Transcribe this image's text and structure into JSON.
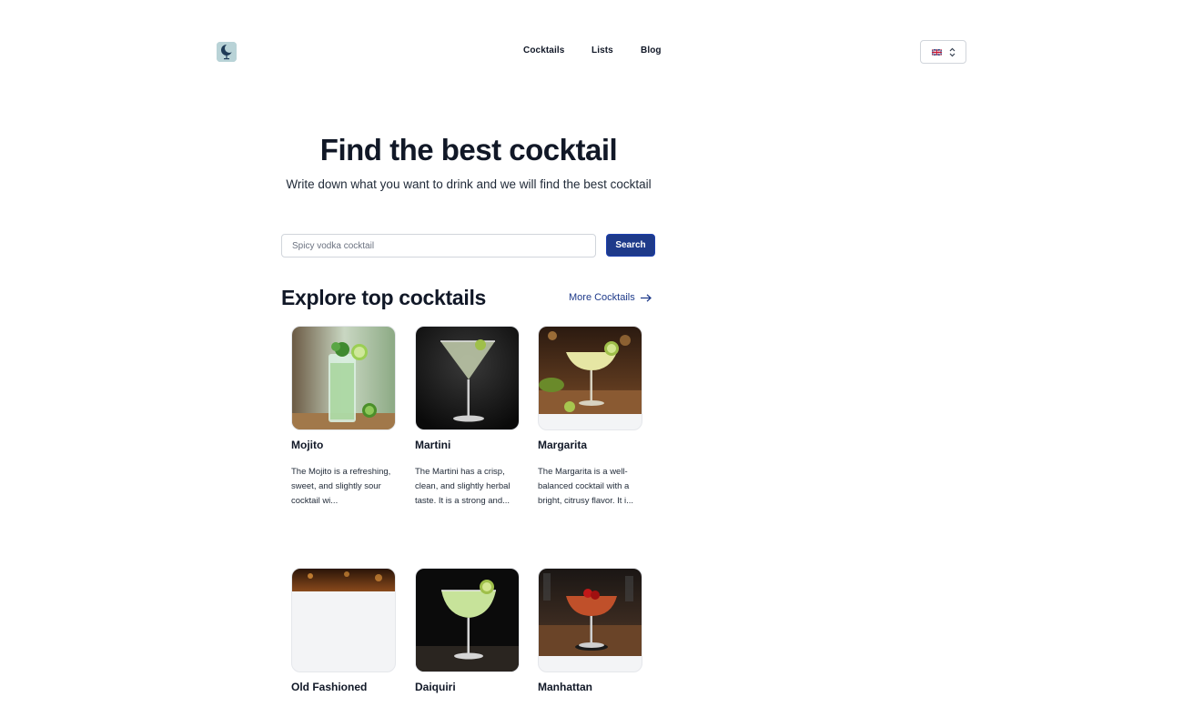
{
  "header": {
    "logo_icon": "moon-glass-icon",
    "nav": [
      {
        "label": "Cocktails"
      },
      {
        "label": "Lists"
      },
      {
        "label": "Blog"
      }
    ],
    "language": {
      "flag": "uk-flag-icon",
      "icon": "chevron-updown-icon"
    }
  },
  "hero": {
    "title": "Find the best cocktail",
    "subtitle": "Write down what you want to drink and we will find the best cocktail"
  },
  "search": {
    "placeholder": "Spicy vodka cocktail",
    "value": "",
    "button_label": "Search"
  },
  "explore": {
    "title": "Explore top cocktails",
    "more_label": "More Cocktails",
    "more_icon": "arrow-right-icon",
    "cards": [
      {
        "name": "Mojito",
        "description": "The Mojito is a refreshing, sweet, and slightly sour cocktail wi..."
      },
      {
        "name": "Martini",
        "description": "The Martini has a crisp, clean, and slightly herbal taste. It is a strong and..."
      },
      {
        "name": "Margarita",
        "description": "The Margarita is a well-balanced cocktail with a bright, citrusy flavor. It i..."
      },
      {
        "name": "Old Fashioned",
        "description": ""
      },
      {
        "name": "Daiquiri",
        "description": ""
      },
      {
        "name": "Manhattan",
        "description": ""
      }
    ]
  },
  "colors": {
    "primary": "#1e3a8a",
    "text": "#111827",
    "border": "#d1d5db"
  }
}
